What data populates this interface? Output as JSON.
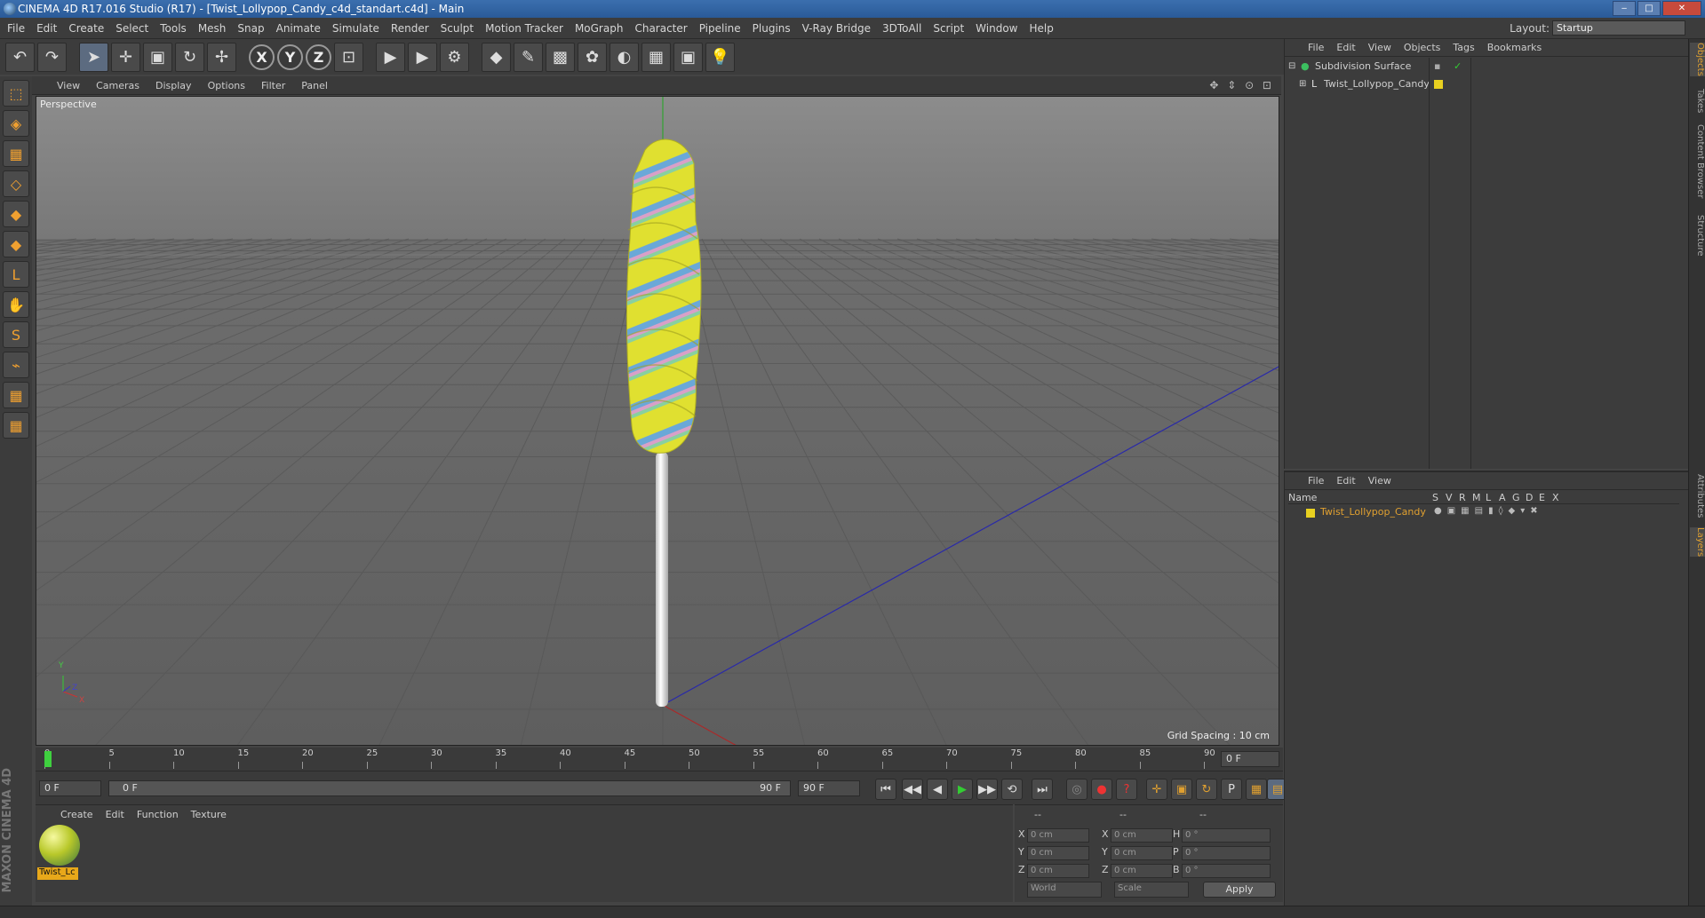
{
  "window": {
    "title": "CINEMA 4D R17.016 Studio (R17) - [Twist_Lollypop_Candy_c4d_standart.c4d] - Main",
    "min": "‒",
    "max": "□",
    "close": "✕"
  },
  "menu": [
    "File",
    "Edit",
    "Create",
    "Select",
    "Tools",
    "Mesh",
    "Snap",
    "Animate",
    "Simulate",
    "Render",
    "Sculpt",
    "Motion Tracker",
    "MoGraph",
    "Character",
    "Pipeline",
    "Plugins",
    "V-Ray Bridge",
    "3DToAll",
    "Script",
    "Window",
    "Help"
  ],
  "layout": {
    "label": "Layout:",
    "value": "Startup"
  },
  "toolbar": {
    "undo": "↶",
    "redo": "↷",
    "select": "➤",
    "move": "✛",
    "scale": "▣",
    "rotate": "↻",
    "transform": "✢",
    "axis_x": "X",
    "axis_y": "Y",
    "axis_z": "Z",
    "coord": "⊡",
    "render_view": "▶",
    "render_pv": "▶",
    "render_settings": "⚙",
    "cube": "◆",
    "pen": "✎",
    "subdiv": "▩",
    "cloner": "✿",
    "deformer": "◐",
    "floor": "▦",
    "camera": "▣",
    "light": "💡"
  },
  "lefttools": [
    "⬚",
    "◈",
    "▦",
    "◇",
    "◆",
    "◆",
    "L",
    "✋",
    "S",
    "⌁",
    "▦",
    "▦"
  ],
  "maxon": "MAXON CINEMA 4D",
  "viewport": {
    "menu": [
      "View",
      "Cameras",
      "Display",
      "Options",
      "Filter",
      "Panel"
    ],
    "nav": "✥ ⇕ ⊙ ⊡",
    "label": "Perspective",
    "grid": "Grid Spacing : 10 cm",
    "axis_y": "Y",
    "axis_x": "X",
    "axis_z": "Z"
  },
  "timeline": {
    "ticks": [
      "0",
      "5",
      "10",
      "15",
      "20",
      "25",
      "30",
      "35",
      "40",
      "45",
      "50",
      "55",
      "60",
      "65",
      "70",
      "75",
      "80",
      "85",
      "90"
    ],
    "current": "0 F"
  },
  "timectl": {
    "start": "0 F",
    "range_start": "0 F",
    "range_end": "90 F",
    "end": "90 F",
    "buttons": [
      "⏮",
      "◀◀",
      "◀",
      "▶",
      "▶▶",
      "⟲",
      "⏭"
    ]
  },
  "materials": {
    "menu": [
      "Create",
      "Edit",
      "Function",
      "Texture"
    ],
    "name": "Twist_Lc"
  },
  "coords": {
    "head": [
      "--",
      "--",
      "--"
    ],
    "rows": [
      {
        "a": "X",
        "av": "0 cm",
        "b": "X",
        "bv": "0 cm",
        "c": "H",
        "cv": "0 °"
      },
      {
        "a": "Y",
        "av": "0 cm",
        "b": "Y",
        "bv": "0 cm",
        "c": "P",
        "cv": "0 °"
      },
      {
        "a": "Z",
        "av": "0 cm",
        "b": "Z",
        "bv": "0 cm",
        "c": "B",
        "cv": "0 °"
      }
    ],
    "space": "World",
    "mode": "Scale",
    "apply": "Apply"
  },
  "objects": {
    "menu": [
      "File",
      "Edit",
      "View",
      "Objects",
      "Tags",
      "Bookmarks"
    ],
    "items": [
      {
        "name": "Subdivision Surface",
        "expand": "⊟"
      },
      {
        "name": "Twist_Lollypop_Candy",
        "expand": "⊞"
      }
    ]
  },
  "layers": {
    "menu": [
      "File",
      "Edit",
      "View"
    ],
    "header": "Name",
    "cols": [
      "S",
      "V",
      "R",
      "M",
      "L",
      "A",
      "G",
      "D",
      "E",
      "X"
    ],
    "item": "Twist_Lollypop_Candy"
  },
  "sidetabs": [
    "Objects",
    "Takes",
    "Content Browser",
    "Structure",
    "Attributes",
    "Layers"
  ],
  "colors": {
    "accent": "#e0a030",
    "layer": "#e8d020"
  }
}
